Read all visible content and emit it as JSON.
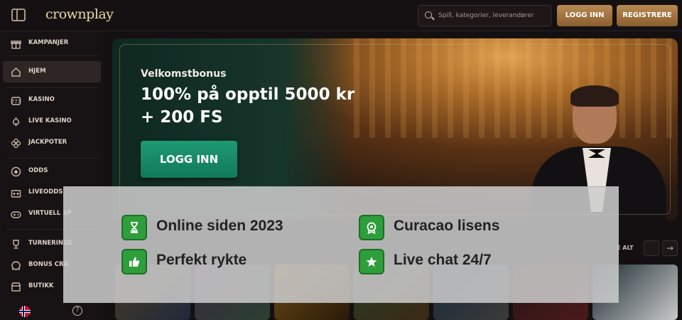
{
  "header": {
    "logo": "crownplay",
    "search_placeholder": "Spill, kategorier, leverandører",
    "login_label": "LOGG INN",
    "register_label": "REGISTRERE"
  },
  "sidebar": {
    "items": [
      {
        "label": "KAMPANJER",
        "icon": "gift-icon"
      },
      {
        "label": "HJEM",
        "icon": "home-icon"
      },
      {
        "label": "KASINO",
        "icon": "slot-machine-icon"
      },
      {
        "label": "LIVE KASINO",
        "icon": "casino-chip-icon"
      },
      {
        "label": "JACKPOTER",
        "icon": "clover-icon"
      },
      {
        "label": "ODDS",
        "icon": "football-icon"
      },
      {
        "label": "LIVEODDS",
        "icon": "live-odds-icon"
      },
      {
        "label": "VIRTUELL SP",
        "icon": "gamepad-icon"
      },
      {
        "label": "TURNERINGE",
        "icon": "trophy-icon"
      },
      {
        "label": "BONUS CRA",
        "icon": "bonus-icon"
      },
      {
        "label": "BUTIKK",
        "icon": "shop-icon"
      }
    ],
    "help_icon": "?"
  },
  "hero": {
    "subtitle": "Velkomstbonus",
    "line1": "100% på opptil 5000 kr",
    "line2": "+ 200 FS",
    "cta_label": "LOGG INN"
  },
  "section": {
    "see_all_label": "E ALT",
    "next_arrow": "→"
  },
  "features": [
    {
      "label": "Online siden 2023",
      "icon": "hourglass-icon"
    },
    {
      "label": "Curacao lisens",
      "icon": "license-badge-icon"
    },
    {
      "label": "Perfekt rykte",
      "icon": "thumbs-up-icon"
    },
    {
      "label": "Live chat 24/7",
      "icon": "star-icon"
    }
  ],
  "colors": {
    "accent_gold": "#b98a52",
    "cta_green": "#1f9a72",
    "feature_green": "#2e9e3c"
  }
}
